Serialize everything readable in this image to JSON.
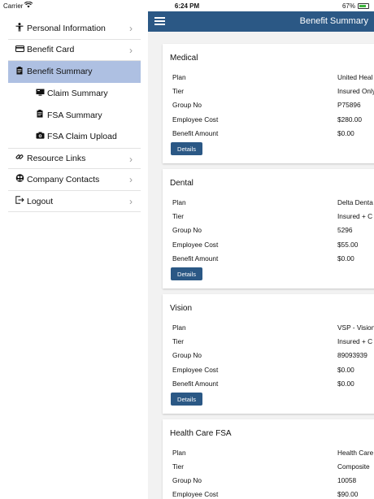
{
  "status_bar": {
    "carrier": "Carrier",
    "time": "6:24 PM",
    "battery": "67%"
  },
  "sidebar": {
    "items": [
      {
        "label": "Personal Information",
        "icon": "person-icon"
      },
      {
        "label": "Benefit Card",
        "icon": "card-icon"
      },
      {
        "label": "Benefit Summary",
        "icon": "clipboard-icon",
        "selected": true
      },
      {
        "label": "Claim Summary",
        "icon": "monitor-icon"
      },
      {
        "label": "FSA Summary",
        "icon": "clipboard-icon"
      },
      {
        "label": "FSA Claim Upload",
        "icon": "camera-icon"
      },
      {
        "label": "Resource Links",
        "icon": "link-icon"
      },
      {
        "label": "Company Contacts",
        "icon": "contacts-icon"
      },
      {
        "label": "Logout",
        "icon": "logout-icon"
      }
    ]
  },
  "header": {
    "title": "Benefit Summary"
  },
  "cards": [
    {
      "title": "Medical",
      "rows": [
        {
          "label": "Plan",
          "value": "United Heal"
        },
        {
          "label": "Tier",
          "value": "Insured Only"
        },
        {
          "label": "Group No",
          "value": "P75896"
        },
        {
          "label": "Employee Cost",
          "value": "$280.00"
        },
        {
          "label": "Benefit Amount",
          "value": "$0.00"
        }
      ],
      "button": "Details"
    },
    {
      "title": "Dental",
      "rows": [
        {
          "label": "Plan",
          "value": "Delta Denta"
        },
        {
          "label": "Tier",
          "value": "Insured + C"
        },
        {
          "label": "Group No",
          "value": "5296"
        },
        {
          "label": "Employee Cost",
          "value": "$55.00"
        },
        {
          "label": "Benefit Amount",
          "value": "$0.00"
        }
      ],
      "button": "Details"
    },
    {
      "title": "Vision",
      "rows": [
        {
          "label": "Plan",
          "value": "VSP - Vision"
        },
        {
          "label": "Tier",
          "value": "Insured + C"
        },
        {
          "label": "Group No",
          "value": "89093939"
        },
        {
          "label": "Employee Cost",
          "value": "$0.00"
        },
        {
          "label": "Benefit Amount",
          "value": "$0.00"
        }
      ],
      "button": "Details"
    },
    {
      "title": "Health Care FSA",
      "rows": [
        {
          "label": "Plan",
          "value": "Health Care"
        },
        {
          "label": "Tier",
          "value": "Composite"
        },
        {
          "label": "Group No",
          "value": "10058"
        },
        {
          "label": "Employee Cost",
          "value": "$90.00"
        }
      ]
    }
  ]
}
